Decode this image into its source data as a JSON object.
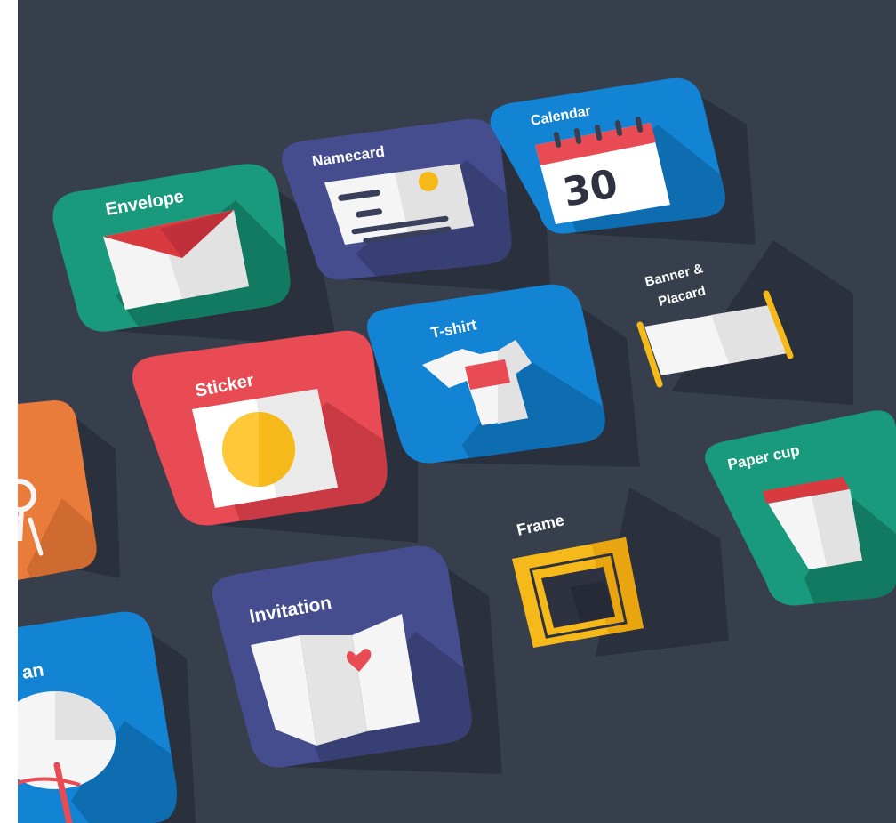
{
  "colors": {
    "background": "#373f4d",
    "green": "#1a9a7c",
    "indigo": "#454d8f",
    "blue": "#1383d4",
    "red": "#e84b54",
    "orange": "#e97b3b",
    "yellow": "#f6b91a"
  },
  "tiles": [
    {
      "id": "envelope",
      "label": "Envelope",
      "icon": "envelope-icon"
    },
    {
      "id": "namecard",
      "label": "Namecard",
      "icon": "namecard-icon"
    },
    {
      "id": "calendar",
      "label": "Calendar",
      "icon": "calendar-icon",
      "day": "30"
    },
    {
      "id": "tshirt",
      "label": "T-shirt",
      "icon": "tshirt-icon"
    },
    {
      "id": "banner",
      "label_line1": "Banner &",
      "label_line2": "Placard",
      "icon": "banner-icon"
    },
    {
      "id": "sticker",
      "label": "Sticker",
      "icon": "sticker-icon"
    },
    {
      "id": "papercup",
      "label": "Paper cup",
      "icon": "paper-cup-icon"
    },
    {
      "id": "frame",
      "label": "Frame",
      "icon": "frame-icon"
    },
    {
      "id": "invitation",
      "label": "Invitation",
      "icon": "invitation-icon"
    },
    {
      "id": "fan",
      "label": "an",
      "icon": "fan-icon"
    },
    {
      "id": "partial-orange",
      "label": "",
      "icon": "balloon-icon"
    }
  ]
}
